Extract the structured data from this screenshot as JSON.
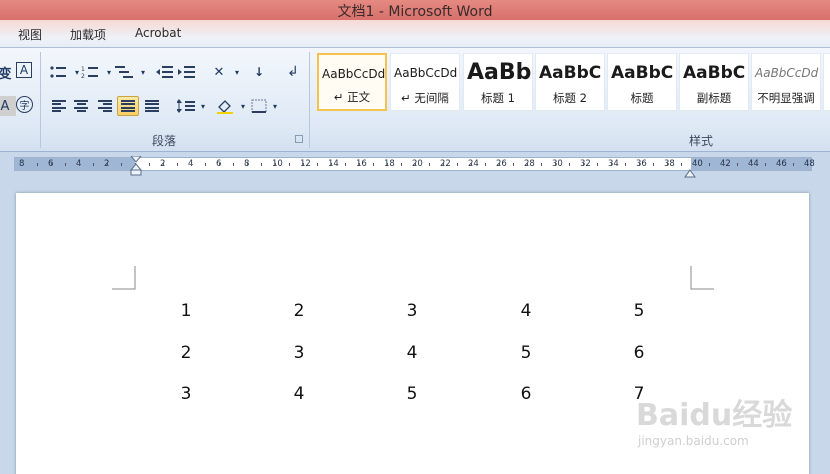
{
  "window": {
    "title": "文档1 - Microsoft Word"
  },
  "tabs": [
    "视图",
    "加载项",
    "Acrobat"
  ],
  "ribbon": {
    "paragraph_group_label": "段落",
    "styles_group_label": "样式",
    "styles": [
      {
        "sample": "AaBbCcDd",
        "name": "↵ 正文",
        "selected": true
      },
      {
        "sample": "AaBbCcDd",
        "name": "↵ 无间隔",
        "selected": false
      },
      {
        "sample": "AaBb",
        "name": "标题 1",
        "selected": false
      },
      {
        "sample": "AaBbC",
        "name": "标题 2",
        "selected": false
      },
      {
        "sample": "AaBbC",
        "name": "标题",
        "selected": false
      },
      {
        "sample": "AaBbC",
        "name": "副标题",
        "selected": false
      },
      {
        "sample": "AaBbCcDd",
        "name": "不明显强调",
        "selected": false
      }
    ],
    "font_glyph_1": "变",
    "font_glyph_2": "A",
    "font_glyph_3": "A",
    "font_glyph_4": "字"
  },
  "ruler": {
    "labels": [
      "8",
      "6",
      "4",
      "2",
      "2",
      "4",
      "6",
      "8",
      "10",
      "12",
      "14",
      "16",
      "18",
      "20",
      "22",
      "24",
      "26",
      "28",
      "30",
      "32",
      "34",
      "36",
      "38",
      "40",
      "42",
      "44",
      "46",
      "48"
    ]
  },
  "document": {
    "table_rows": [
      [
        "1",
        "2",
        "3",
        "4",
        "5"
      ],
      [
        "2",
        "3",
        "4",
        "5",
        "6"
      ],
      [
        "3",
        "4",
        "5",
        "6",
        "7"
      ]
    ]
  },
  "watermark": {
    "brand": "Baidu经验",
    "url": "jingyan.baidu.com"
  },
  "colors": {
    "accent_selected": "#f3c24f",
    "titlebar": "#d6706b",
    "ribbon_bg": "#dde8f5"
  }
}
